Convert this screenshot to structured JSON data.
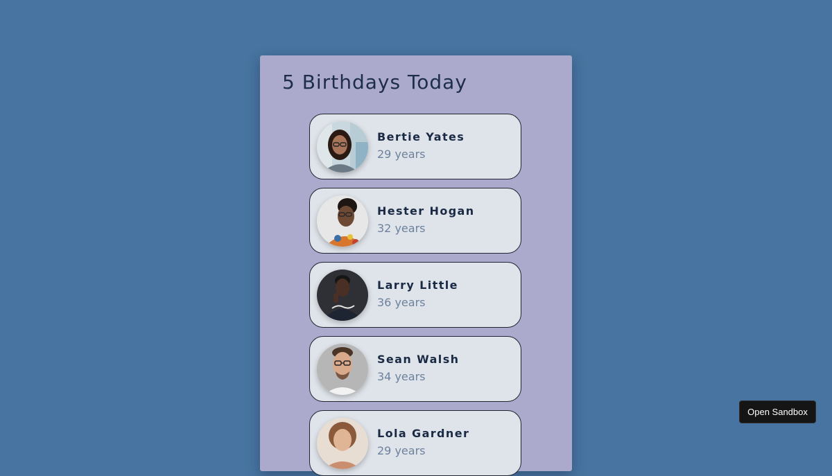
{
  "title": "5 Birthdays Today",
  "people": [
    {
      "name": "Bertie Yates",
      "age": "29 years"
    },
    {
      "name": "Hester Hogan",
      "age": "32 years"
    },
    {
      "name": "Larry Little",
      "age": "36 years"
    },
    {
      "name": "Sean Walsh",
      "age": "34 years"
    },
    {
      "name": "Lola Gardner",
      "age": "29 years"
    }
  ],
  "sandbox_button": "Open Sandbox",
  "colors": {
    "page_background": "#4774a0",
    "card_background": "#abaacd",
    "item_background": "#dfe4ea",
    "name_text": "#1a2a44",
    "age_text": "#6d819c"
  }
}
